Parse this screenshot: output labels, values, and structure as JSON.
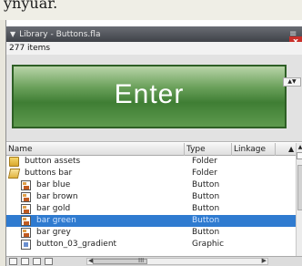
{
  "page": {
    "overflow_text": "ynyuar."
  },
  "panel": {
    "title": "Library - Buttons.fla",
    "item_count": "277 items",
    "close_label": "x",
    "menu_icon": "menu-icon"
  },
  "preview": {
    "button_text": "Enter",
    "control_label": "▲▼"
  },
  "columns": {
    "name": "Name",
    "type": "Type",
    "linkage": "Linkage",
    "sort_indicator": "▲"
  },
  "items": [
    {
      "name": "button assets",
      "type": "Folder",
      "icon": "folder-icon",
      "selected": false,
      "indent": 0
    },
    {
      "name": "buttons bar",
      "type": "Folder",
      "icon": "folder-open-icon",
      "selected": false,
      "indent": 0
    },
    {
      "name": "bar blue",
      "type": "Button",
      "icon": "button-symbol-icon",
      "selected": false,
      "indent": 1
    },
    {
      "name": "bar brown",
      "type": "Button",
      "icon": "button-symbol-icon",
      "selected": false,
      "indent": 1
    },
    {
      "name": "bar gold",
      "type": "Button",
      "icon": "button-symbol-icon",
      "selected": false,
      "indent": 1
    },
    {
      "name": "bar green",
      "type": "Button",
      "icon": "button-symbol-icon",
      "selected": true,
      "indent": 1
    },
    {
      "name": "bar grey",
      "type": "Button",
      "icon": "button-symbol-icon",
      "selected": false,
      "indent": 1
    },
    {
      "name": "button_03_gradient",
      "type": "Graphic",
      "icon": "graphic-symbol-icon",
      "selected": false,
      "indent": 1
    }
  ],
  "bottom_bar": {
    "scroll_label": "III",
    "left_arrow": "◀",
    "right_arrow": "▶"
  },
  "colors": {
    "selection": "#2f7bd0",
    "titlebar": "#4a4d53",
    "close": "#c8302a",
    "button_green": "#4f8c43"
  }
}
